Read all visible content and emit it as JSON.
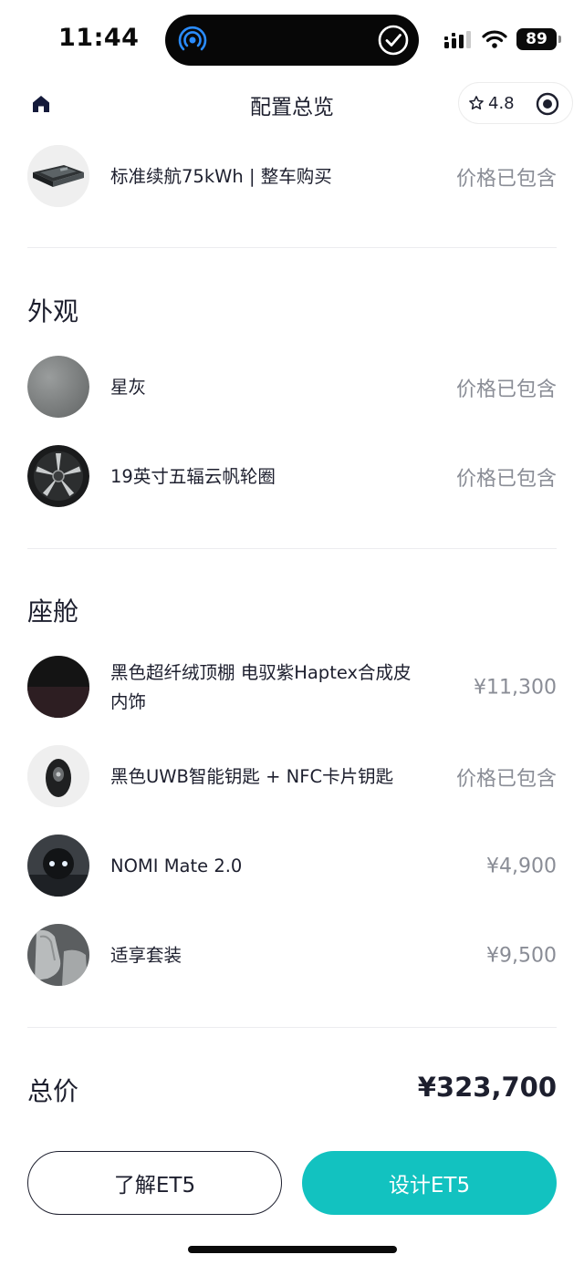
{
  "status_bar": {
    "time": "11:44",
    "battery": "89"
  },
  "nav": {
    "title": "配置总览",
    "rating": "4.8"
  },
  "top_item": {
    "title": "标准续航75kWh | 整车购买",
    "price": "价格已包含"
  },
  "sections": [
    {
      "title": "外观",
      "items": [
        {
          "title": "星灰",
          "price": "价格已包含"
        },
        {
          "title": "19英寸五辐云帆轮圈",
          "price": "价格已包含"
        }
      ]
    },
    {
      "title": "座舱",
      "items": [
        {
          "title": "黑色超纤绒顶棚 电驭紫Haptex合成皮内饰",
          "price": "¥11,300"
        },
        {
          "title": "黑色UWB智能钥匙 + NFC卡片钥匙",
          "price": "价格已包含"
        },
        {
          "title": "NOMI Mate 2.0",
          "price": "¥4,900"
        },
        {
          "title": "适享套装",
          "price": "¥9,500"
        }
      ]
    }
  ],
  "total": {
    "label": "总价",
    "value": "¥323,700"
  },
  "buttons": {
    "learn": "了解ET5",
    "design": "设计ET5"
  },
  "colors": {
    "accent": "#12c2c0",
    "text": "#1d1f2e",
    "muted": "#8a8d96"
  }
}
